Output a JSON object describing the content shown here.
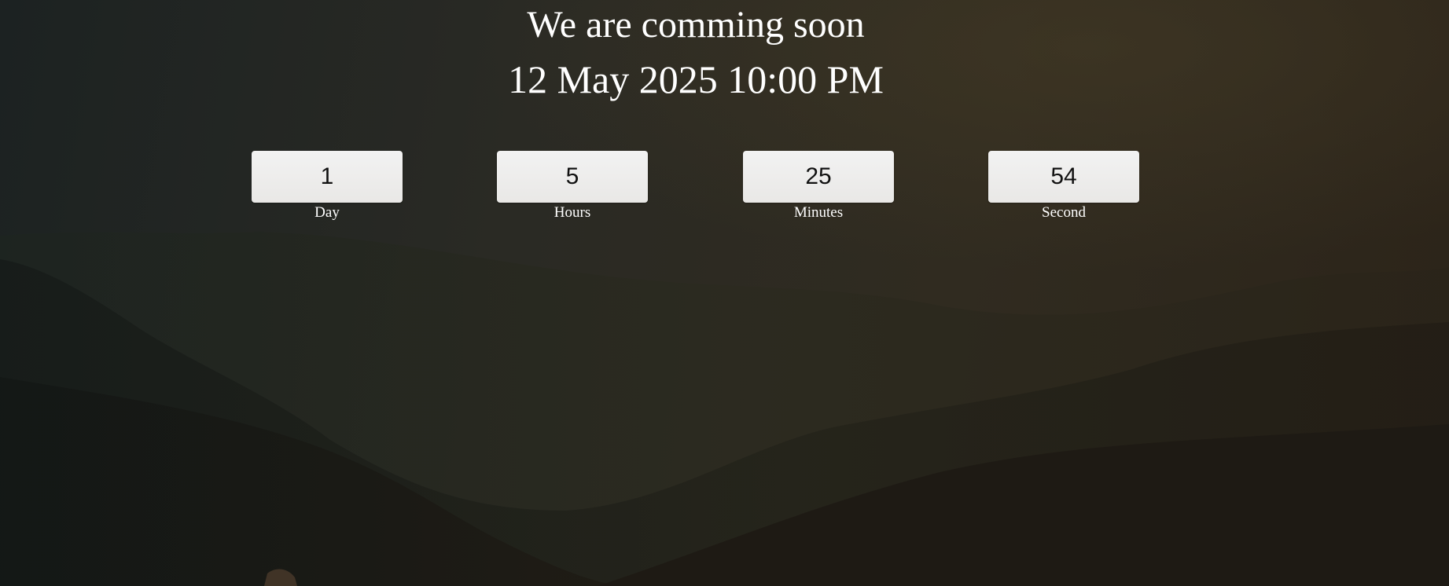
{
  "heading": "We are comming soon",
  "launch_date": "12 May 2025 10:00 PM",
  "countdown": [
    {
      "value": "1",
      "label": "Day"
    },
    {
      "value": "5",
      "label": "Hours"
    },
    {
      "value": "25",
      "label": "Minutes"
    },
    {
      "value": "54",
      "label": "Second"
    }
  ],
  "background": {
    "image": "dark forested mountain valley",
    "overlay_color": "#24231e"
  }
}
